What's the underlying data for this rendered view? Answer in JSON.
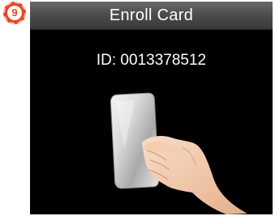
{
  "step_badge": {
    "number": "9",
    "color": "#e8451e"
  },
  "window": {
    "title": "Enroll Card",
    "background": "#000000",
    "title_bar_color": "#4d4d4d"
  },
  "card": {
    "id_prefix": "ID:",
    "id_value": "0013378512",
    "id_line": "ID: 0013378512"
  },
  "illustration": {
    "icon": "hand-holding-card-icon"
  }
}
